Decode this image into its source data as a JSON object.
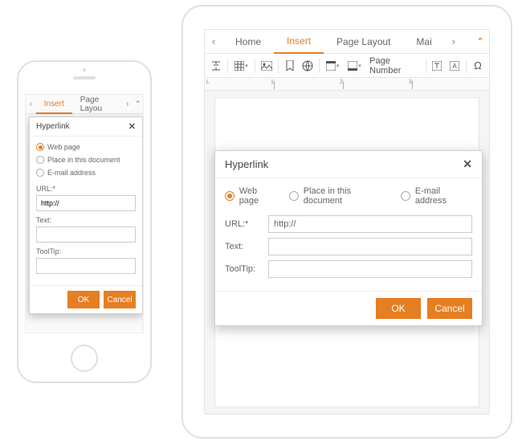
{
  "tabs": {
    "home": "Home",
    "insert": "Insert",
    "pageLayout": "Page Layout",
    "mail": "Mai"
  },
  "phoneTabs": {
    "insert": "Insert",
    "pageLayout": "Page Layou"
  },
  "toolbar": {
    "pageNumber": "Page Number"
  },
  "dialog": {
    "title": "Hyperlink",
    "radios": {
      "web": "Web page",
      "place": "Place in this document",
      "email": "E-mail address"
    },
    "fields": {
      "url_label": "URL:*",
      "url_value": "http://",
      "text_label": "Text:",
      "text_value": "",
      "tooltip_label": "ToolTip:",
      "tooltip_value": ""
    },
    "buttons": {
      "ok": "OK",
      "cancel": "Cancel"
    }
  },
  "ruler": {
    "labels": [
      "L",
      "1",
      "2",
      "3"
    ]
  }
}
